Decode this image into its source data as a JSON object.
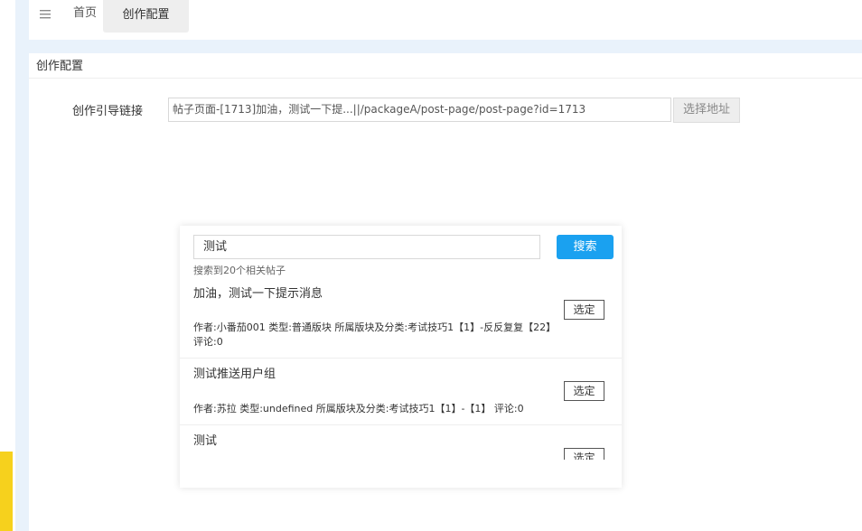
{
  "nav": {
    "menu_icon": "hamburger-menu-icon",
    "home_label": "首页",
    "active_tab_label": "创作配置"
  },
  "panel": {
    "title": "创作配置",
    "field_label": "创作引导链接",
    "link_value": "帖子页面-[1713]加油，测试一下提...||/packageA/post-page/post-page?id=1713",
    "choose_button": "选择地址"
  },
  "popup": {
    "search_value": "测试",
    "search_button": "搜索",
    "result_count_text": "搜索到20个相关帖子",
    "select_label": "选定",
    "results": [
      {
        "title": "加油，测试一下提示消息",
        "meta": "作者:小番茄001   类型:普通版块   所属版块及分类:考试技巧1【1】-反反复复【22】   评论:0"
      },
      {
        "title": "测试推送用户组",
        "meta": "作者:苏拉   类型:undefined   所属版块及分类:考试技巧1【1】-【1】   评论:0"
      },
      {
        "title": "测试",
        "meta": ""
      }
    ]
  },
  "colors": {
    "primary": "#1aa1f0",
    "gutter": "#e9f2fb",
    "accent_yellow": "#f6d11d"
  }
}
